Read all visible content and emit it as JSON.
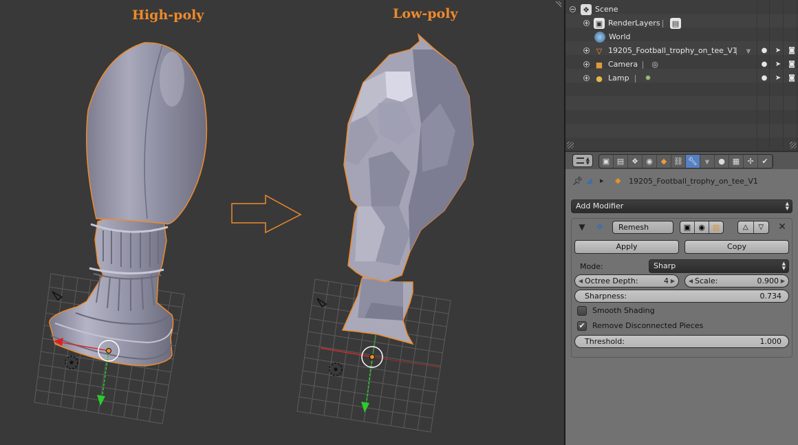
{
  "viewport": {
    "label_left": "High-poly",
    "label_right": "Low-poly"
  },
  "outliner": {
    "rows": [
      {
        "name": "Scene",
        "icon": "scene-icon"
      },
      {
        "name": "RenderLayers",
        "icon": "render-layers-icon"
      },
      {
        "name": "World",
        "icon": "world-icon"
      },
      {
        "name": "19205_Football_trophy_on_tee_V1",
        "icon": "mesh-object-icon"
      },
      {
        "name": "Camera",
        "icon": "camera-icon"
      },
      {
        "name": "Lamp",
        "icon": "lamp-icon"
      }
    ]
  },
  "properties": {
    "breadcrumb_object": "19205_Football_trophy_on_tee_V1",
    "add_modifier_label": "Add Modifier",
    "modifier": {
      "name": "Remesh",
      "apply_label": "Apply",
      "copy_label": "Copy",
      "mode_label": "Mode:",
      "mode_value": "Sharp",
      "octree_depth_label": "Octree Depth:",
      "octree_depth_value": "4",
      "scale_label": "Scale:",
      "scale_value": "0.900",
      "sharpness_label": "Sharpness:",
      "sharpness_value": "0.734",
      "smooth_shading_label": "Smooth Shading",
      "smooth_shading_checked": false,
      "remove_disconnected_label": "Remove Disconnected Pieces",
      "remove_disconnected_checked": true,
      "threshold_label": "Threshold:",
      "threshold_value": "1.000"
    }
  },
  "colors": {
    "label_orange": "#ef8a2a",
    "active_tab_blue": "#5680c2",
    "viewport_bg": "#393939"
  }
}
